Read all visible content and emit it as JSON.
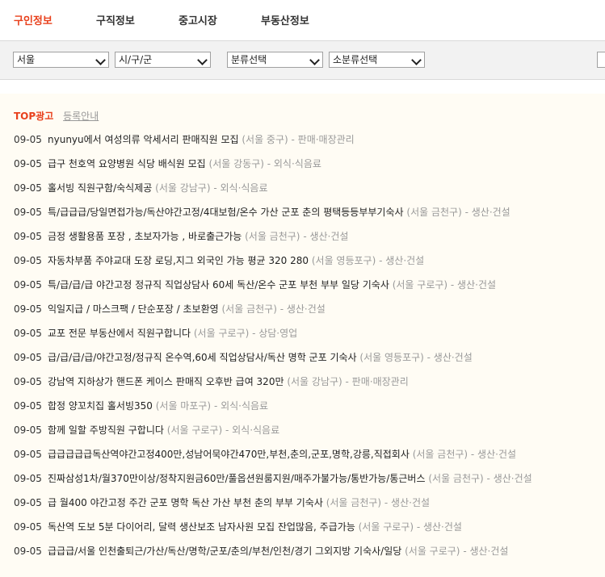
{
  "nav": {
    "tabs": [
      {
        "label": "구인정보",
        "active": true
      },
      {
        "label": "구직정보",
        "active": false
      },
      {
        "label": "중고시장",
        "active": false
      },
      {
        "label": "부동산정보",
        "active": false
      }
    ]
  },
  "filters": {
    "region": "서울",
    "district": "시/구/군",
    "category": "분류선택",
    "subcategory": "소분류선택"
  },
  "section": {
    "title": "TOP광고",
    "register_link": "등록안내"
  },
  "listings": [
    {
      "date": "09-05",
      "title": "nyunyu에서 여성의류 악세서리 판매직원 모집",
      "loc": "(서울 중구)",
      "cat": " - 판매·매장관리"
    },
    {
      "date": "09-05",
      "title": "급구 천호역 요양병원 식당 배식원 모집",
      "loc": "(서울 강동구)",
      "cat": " - 외식·식음료"
    },
    {
      "date": "09-05",
      "title": "홀서빙 직원구함/숙식제공",
      "loc": "(서울 강남구)",
      "cat": " - 외식·식음료"
    },
    {
      "date": "09-05",
      "title": "특/급급급/당일면접가능/독산야간고정/4대보험/온수 가산 군포 춘의 평택등등부부기숙사",
      "loc": "(서울 금천구)",
      "cat": " - 생산·건설"
    },
    {
      "date": "09-05",
      "title": "금정 생활용품 포장 , 초보자가능 , 바로출근가능",
      "loc": "(서울 금천구)",
      "cat": " - 생산·건설"
    },
    {
      "date": "09-05",
      "title": "자동차부품 주야교대 도장 로딩,지그 외국인 가능 평균 320 280",
      "loc": "(서울 영등포구)",
      "cat": " - 생산·건설"
    },
    {
      "date": "09-05",
      "title": "특/급/급/급 야간고정 정규직 직업상담사 60세 독산/온수 군포 부천 부부 일당 기숙사",
      "loc": "(서울 구로구)",
      "cat": " - 생산·건설"
    },
    {
      "date": "09-05",
      "title": "익일지급 / 마스크팩 / 단순포장 / 초보환영",
      "loc": "(서울 금천구)",
      "cat": " - 생산·건설"
    },
    {
      "date": "09-05",
      "title": "교포 전문 부동산에서 직원구합니다",
      "loc": "(서울 구로구)",
      "cat": " - 상담·영업"
    },
    {
      "date": "09-05",
      "title": "급/급/급/급/야간고정/정규직 온수역,60세 직업상담사/독산 명학 군포 기숙사",
      "loc": "(서울 영등포구)",
      "cat": " - 생산·건설"
    },
    {
      "date": "09-05",
      "title": "강남역 지하상가 핸드폰 케이스 판매직 오후반 급여 320만",
      "loc": "(서울 강남구)",
      "cat": " - 판매·매장관리"
    },
    {
      "date": "09-05",
      "title": "합정 양꼬치집 홀서빙350",
      "loc": "(서울 마포구)",
      "cat": " - 외식·식음료"
    },
    {
      "date": "09-05",
      "title": "함께 일할 주방직원 구합니다",
      "loc": "(서울 구로구)",
      "cat": " - 외식·식음료"
    },
    {
      "date": "09-05",
      "title": "급급급급급독산역야간고정400만,성남어묵야간470만,부천,춘의,군포,명학,강릉,직접회사",
      "loc": "(서울 금천구)",
      "cat": " - 생산·건설"
    },
    {
      "date": "09-05",
      "title": "진짜삼성1차/월370만이상/정착지원금60만/풀옵션원룸지원/매주가불가능/통반가능/통근버스",
      "loc": "(서울 금천구)",
      "cat": " - 생산·건설"
    },
    {
      "date": "09-05",
      "title": "급 월400 야간고정 주간 군포 명학 독산 가산 부천 춘의 부부 기숙사",
      "loc": "(서울 금천구)",
      "cat": " - 생산·건설"
    },
    {
      "date": "09-05",
      "title": "독산역 도보 5분 다이어리, 달력 생산보조 남자사원 모집 잔업많음, 주급가능",
      "loc": "(서울 구로구)",
      "cat": " - 생산·건설"
    },
    {
      "date": "09-05",
      "title": "급급급/서울 인천출퇴근/가산/독산/명학/군포/춘의/부천/인천/경기 그외지방 기숙사/일당",
      "loc": "(서울 구로구)",
      "cat": " - 생산·건설"
    }
  ]
}
